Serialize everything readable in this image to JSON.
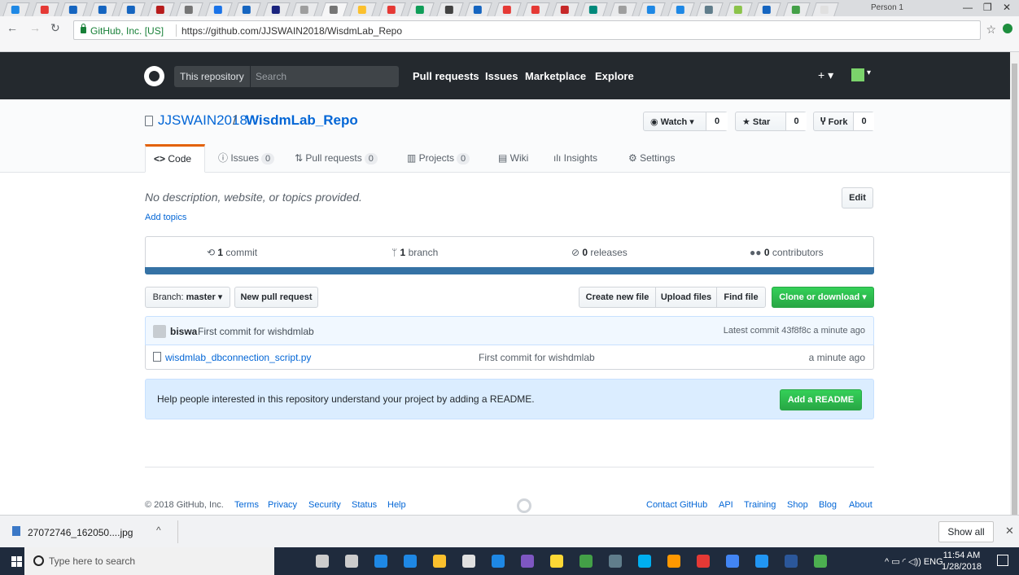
{
  "browser": {
    "profile": "Person 1",
    "secure_label": "GitHub, Inc. [US]",
    "url": "https://github.com/JJSWAIN2018/WisdmLab_Repo",
    "tab_colors": [
      "#1e88e5",
      "#e53935",
      "#1565c0",
      "#1565c0",
      "#1565c0",
      "#b71c1c",
      "#757575",
      "#1a73e8",
      "#1565c0",
      "#1a237e",
      "#9e9e9e",
      "#757575",
      "#fbc02d",
      "#e53935",
      "#0f9d58",
      "#424242",
      "#1565c0",
      "#e53935",
      "#e53935",
      "#c62828",
      "#00897b",
      "#9e9e9e",
      "#1e88e5",
      "#1e88e5",
      "#607d8b",
      "#8bc34a",
      "#1565c0",
      "#43a047",
      "#e0e0e0"
    ]
  },
  "gh_header": {
    "search_scope": "This repository",
    "search_placeholder": "Search",
    "links": [
      "Pull requests",
      "Issues",
      "Marketplace",
      "Explore"
    ],
    "plus": "+ ▾",
    "avatar_caret": "▾"
  },
  "repo": {
    "owner": "JJSWAIN2018",
    "slash": "/",
    "name": "WisdmLab_Repo",
    "watch_label": "Watch ▾",
    "watch_count": "0",
    "star_label": "Star",
    "star_count": "0",
    "fork_label": "Fork",
    "fork_count": "0"
  },
  "tabs": {
    "code": "Code",
    "issues": "Issues",
    "issues_count": "0",
    "pulls": "Pull requests",
    "pulls_count": "0",
    "projects": "Projects",
    "projects_count": "0",
    "wiki": "Wiki",
    "insights": "Insights",
    "settings": "Settings"
  },
  "description": {
    "text": "No description, website, or topics provided.",
    "add_topics": "Add topics",
    "edit": "Edit"
  },
  "summary": {
    "commits_num": "1",
    "commits_label": "commit",
    "branches_num": "1",
    "branches_label": "branch",
    "releases_num": "0",
    "releases_label": "releases",
    "contributors_num": "0",
    "contributors_label": "contributors"
  },
  "filenav": {
    "branch_prefix": "Branch:",
    "branch": "master ▾",
    "new_pr": "New pull request",
    "create_file": "Create new file",
    "upload": "Upload files",
    "find": "Find file",
    "clone": "Clone or download ▾"
  },
  "commit": {
    "author": "biswa",
    "message": "First commit for wishdmlab",
    "latest": "Latest commit 43f8f8c a minute ago"
  },
  "files": [
    {
      "name": "wisdmlab_dbconnection_script.py",
      "message": "First commit for wishdmlab",
      "age": "a minute ago"
    }
  ],
  "readme": {
    "text": "Help people interested in this repository understand your project by adding a README.",
    "button": "Add a README"
  },
  "footer": {
    "copyright": "© 2018 GitHub, Inc.",
    "left_links": [
      "Terms",
      "Privacy",
      "Security",
      "Status",
      "Help"
    ],
    "right_links": [
      "Contact GitHub",
      "API",
      "Training",
      "Shop",
      "Blog",
      "About"
    ]
  },
  "downloads": {
    "file": "27072746_162050....jpg",
    "caret": "^",
    "show_all": "Show all"
  },
  "taskbar": {
    "search_placeholder": "Type here to search",
    "tray": "^ ▭ ◜ ◁)) ENG",
    "time": "11:54 AM",
    "date": "1/28/2018",
    "icon_colors": [
      "#cccccc",
      "#cccccc",
      "#1e88e5",
      "#1e88e5",
      "#fbc02d",
      "#e0e0e0",
      "#1e88e5",
      "#7e57c2",
      "#fdd835",
      "#43a047",
      "#607d8b",
      "#00aff0",
      "#ff9800",
      "#e53935",
      "#4285f4",
      "#2196f3",
      "#2b579a",
      "#4caf50"
    ]
  }
}
